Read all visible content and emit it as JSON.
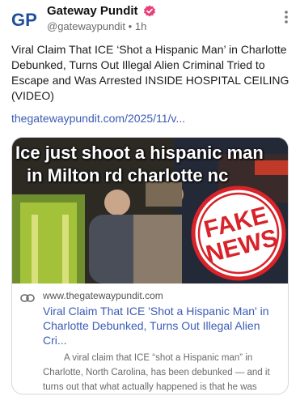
{
  "account": {
    "name": "Gateway Pundit",
    "handle": "@gatewaypundit",
    "separator": "•",
    "time": "1h",
    "avatar_letters": "GP"
  },
  "post": {
    "text": "Viral Claim That ICE ‘Shot a Hispanic Man’ in Charlotte Debunked, Turns Out Illegal Alien Criminal Tried to Escape and Was Arrested INSIDE HOSPITAL CEILING (VIDEO)",
    "link": "thegatewaypundit.com/2025/11/v..."
  },
  "card": {
    "image_caption_line1": "Ice just shoot a hispanic man",
    "image_caption_line2": "in Milton rd charlotte nc",
    "stamp_line1": "FAKE",
    "stamp_line2": "NEWS",
    "domain": "www.thegatewaypundit.com",
    "title": "Viral Claim That ICE 'Shot a Hispanic Man' in Charlotte Debunked, Turns Out Illegal Alien Cri...",
    "description": "A viral claim that ICE “shot a Hispanic man” in Charlotte, North Carolina, has been debunked — and it turns out that what actually happened is that he was arrested inside a hospital ceiling while attempting to e..."
  },
  "icons": {
    "verified": "verified-badge-icon",
    "more": "more-vertical-icon",
    "link": "link-icon"
  },
  "colors": {
    "link": "#3b5bb5",
    "verified": "#e8417a",
    "stamp": "#d8232a"
  }
}
